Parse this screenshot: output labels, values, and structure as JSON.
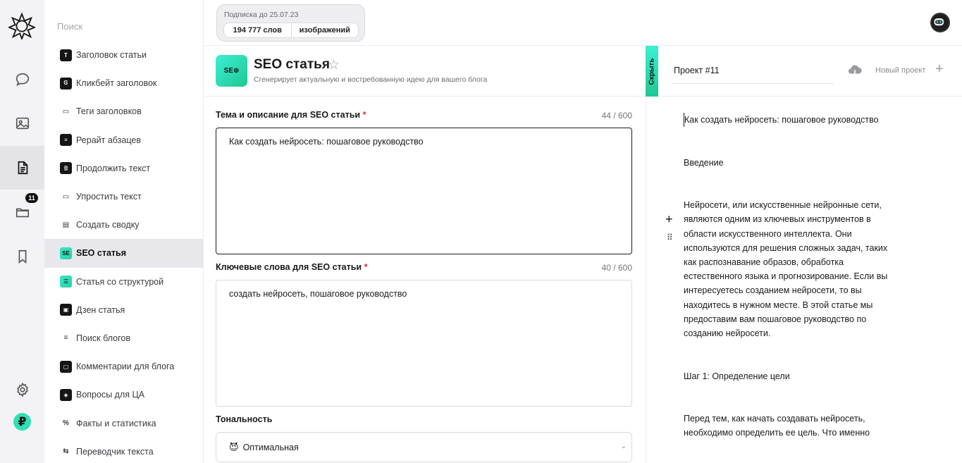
{
  "search": {
    "placeholder": "Поиск"
  },
  "rail": {
    "folder_badge": "11",
    "currency": "₽"
  },
  "sidebar": {
    "items": [
      {
        "label": "Заголовок статьи",
        "icon": "T"
      },
      {
        "label": "Кликбейт заголовок",
        "icon": "Ꮆ"
      },
      {
        "label": "Теги заголовков",
        "icon": "▭"
      },
      {
        "label": "Рерайт абзацев",
        "icon": "≡"
      },
      {
        "label": "Продолжить текст",
        "icon": "≣"
      },
      {
        "label": "Упростить текст",
        "icon": "▭"
      },
      {
        "label": "Создать сводку",
        "icon": "▤"
      },
      {
        "label": "SEO статья",
        "icon": "SE"
      },
      {
        "label": "Статья со структурой",
        "icon": "☰"
      },
      {
        "label": "Дзен статья",
        "icon": "▣"
      },
      {
        "label": "Поиск блогов",
        "icon": "≡"
      },
      {
        "label": "Комментарии для блога",
        "icon": "▢"
      },
      {
        "label": "Вопросы для ЦА",
        "icon": "◈"
      },
      {
        "label": "Факты и статистика",
        "icon": "%"
      },
      {
        "label": "Переводчик текста",
        "icon": "⇆"
      }
    ]
  },
  "subscription": {
    "title": "Подписка до 25.07.23",
    "words": "194 777 слов",
    "images": "изображений"
  },
  "page": {
    "icon_text": "SE⊕",
    "title": "SEO статья",
    "subtitle": "Сгенерирует актуальную и востребованную идею для вашего блога"
  },
  "form": {
    "topic": {
      "label": "Тема и описание для SEO статьи",
      "required": "*",
      "counter": "44 / 600",
      "value": "Как создать нейросеть: пошаговое руководство"
    },
    "keywords": {
      "label": "Ключевые слова для SEO статьи",
      "required": "*",
      "counter": "40 / 600",
      "value": "создать нейросеть, пошаговое руководство"
    },
    "tone": {
      "label": "Тональность",
      "value": "Оптимальная",
      "emoji": "😈"
    }
  },
  "doc_panel": {
    "hide_label": "Скрыть",
    "project_name": "Проект #11",
    "new_project": "Новый проект",
    "paragraphs": [
      "Как создать нейросеть: пошаговое руководство",
      "Введение",
      "Нейросети, или искусственные нейронные сети, являются одним из ключевых инструментов в области искусственного интеллекта. Они используются для решения сложных задач, таких как распознавание образов, обработка естественного языка и прогнозирование. Если вы интересуетесь созданием нейросети, то вы находитесь в нужном месте. В этой статье мы предоставим вам пошаговое руководство по созданию нейросети.",
      "Шаг 1: Определение цели",
      "Перед тем, как начать создавать нейросеть, необходимо определить ее цель. Что именно"
    ]
  },
  "colors": {
    "accent": "#2fe0b4",
    "active_bg": "#e8e8ec",
    "required": "#e0302b"
  }
}
